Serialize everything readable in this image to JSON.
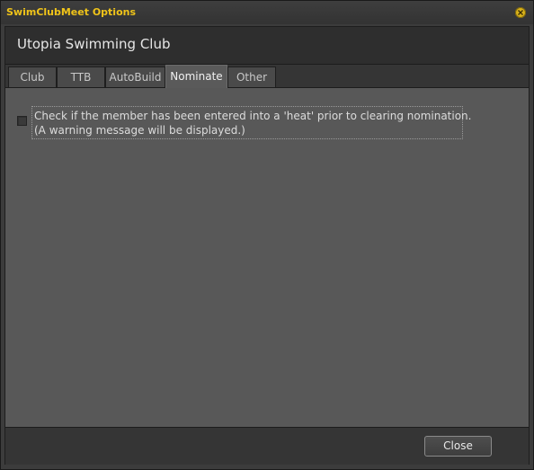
{
  "window": {
    "title": "SwimClubMeet Options"
  },
  "header": {
    "club_name": "Utopia Swimming Club"
  },
  "tabs": [
    {
      "label": "Club"
    },
    {
      "label": "TTB"
    },
    {
      "label": "AutoBuild"
    },
    {
      "label": "Nominate",
      "active": true
    },
    {
      "label": "Other"
    }
  ],
  "nominate": {
    "checkbox_checked": false,
    "label_line1": "Check if the member has been entered into a 'heat' prior to clearing nomination.",
    "label_line2": "(A warning message will be displayed.)"
  },
  "footer": {
    "close_label": "Close"
  },
  "colors": {
    "title_accent": "#f0c419",
    "window_bg": "#585858"
  },
  "icons": {
    "window_close": "close-x-icon"
  }
}
